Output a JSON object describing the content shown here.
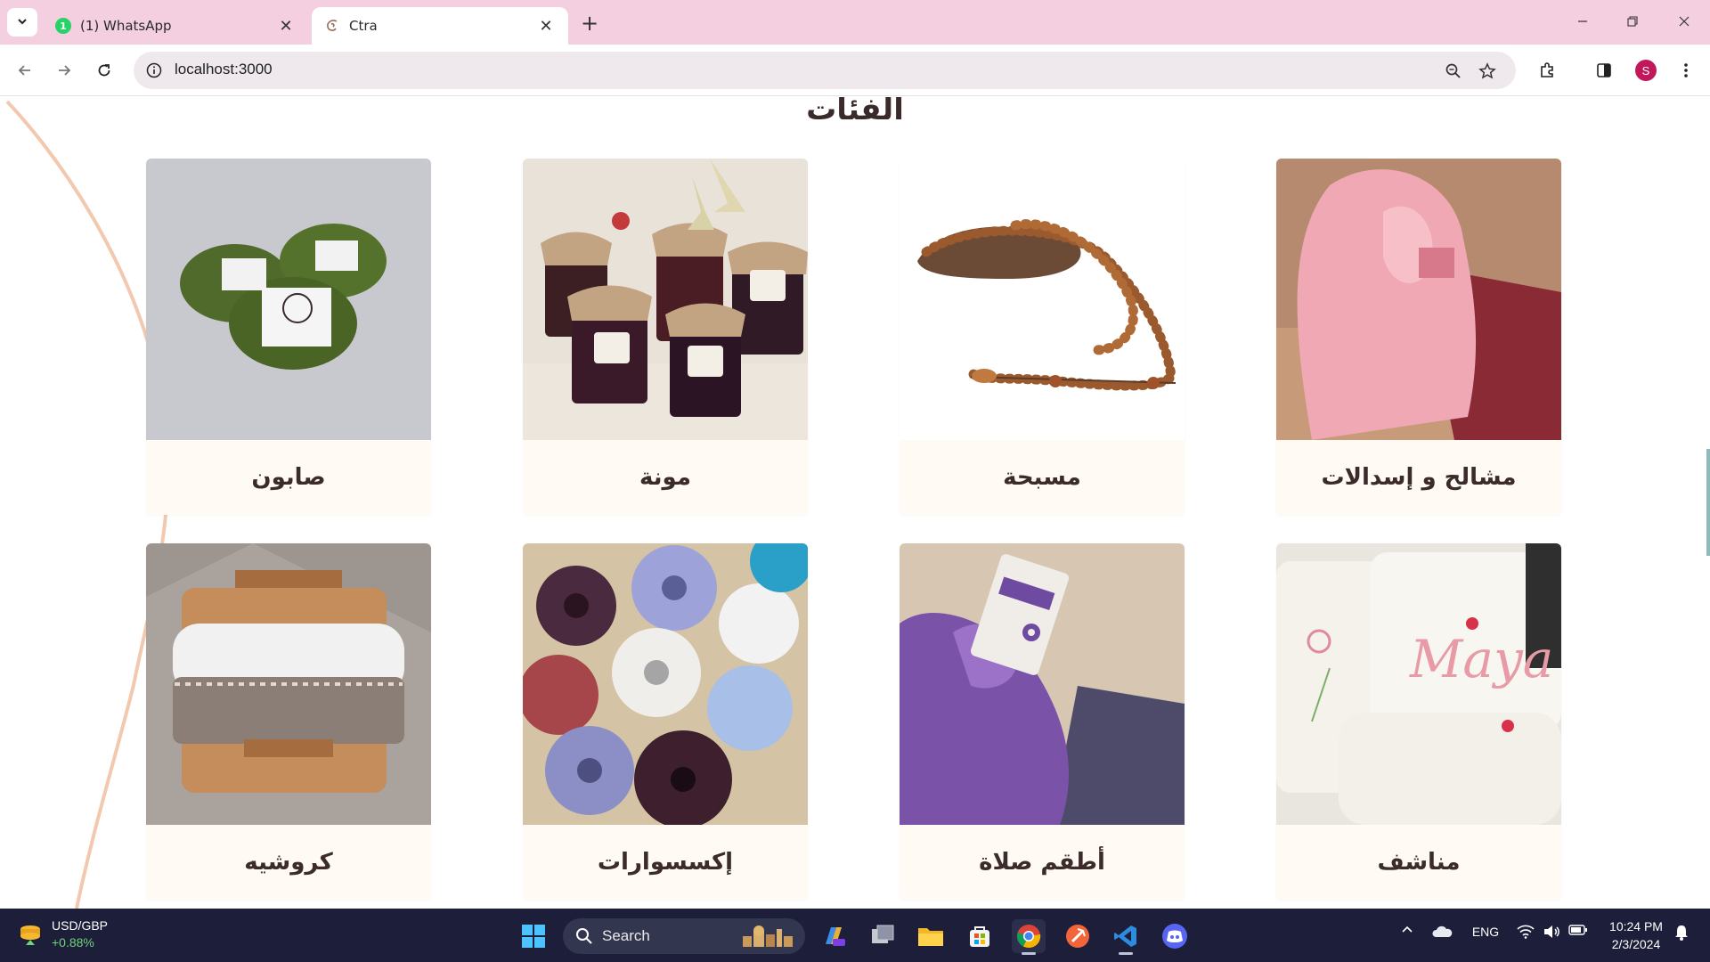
{
  "browser": {
    "tabs": [
      {
        "title": "(1) WhatsApp",
        "favicon": "whatsapp-icon",
        "badge": "1",
        "active": false
      },
      {
        "title": "Ctra",
        "favicon": "site-logo-icon",
        "active": true
      }
    ],
    "new_tab_icon": "plus-icon",
    "address_bar": {
      "url": "localhost:3000"
    },
    "toolbar_icons": [
      "back-icon",
      "forward-icon",
      "reload-icon",
      "site-info-icon",
      "zoom-icon",
      "bookmark-star-icon",
      "extensions-icon",
      "side-panel-icon",
      "menu-icon"
    ],
    "profile_initial": "S",
    "window_controls": [
      "minimize-icon",
      "restore-icon",
      "close-icon"
    ]
  },
  "page": {
    "section_title": "الفئات",
    "categories": [
      {
        "label": "صابون",
        "image": "green soap bars"
      },
      {
        "label": "مونة",
        "image": "jam jars"
      },
      {
        "label": "مسبحة",
        "image": "prayer beads"
      },
      {
        "label": "مشالح و إسدالات",
        "image": "prayer garment"
      },
      {
        "label": "كروشيه",
        "image": "tissue box cover"
      },
      {
        "label": "إكسسوارات",
        "image": "hair scrunchies"
      },
      {
        "label": "أطقم صلاة",
        "image": "prayer set"
      },
      {
        "label": "مناشف",
        "image": "embroidered towels"
      }
    ],
    "colors": {
      "card_bg": "#fffaf3",
      "accent_line": "#f0c5a8",
      "title_text": "#3a2a2a"
    }
  },
  "taskbar": {
    "widget": {
      "pair": "USD/GBP",
      "change": "+0.88%"
    },
    "search_placeholder": "Search",
    "apps": [
      "windows-start-icon",
      "search-icon",
      "copilot-icon",
      "task-view-icon",
      "file-explorer-icon",
      "store-icon",
      "chrome-icon",
      "brave-icon",
      "vscode-icon",
      "discord-icon"
    ],
    "tray": {
      "language": "ENG",
      "icons": [
        "chevron-up-icon",
        "onedrive-icon",
        "wifi-icon",
        "volume-icon",
        "battery-icon",
        "notification-bell-icon"
      ]
    },
    "clock": {
      "time": "10:24 PM",
      "date": "2/3/2024"
    }
  }
}
